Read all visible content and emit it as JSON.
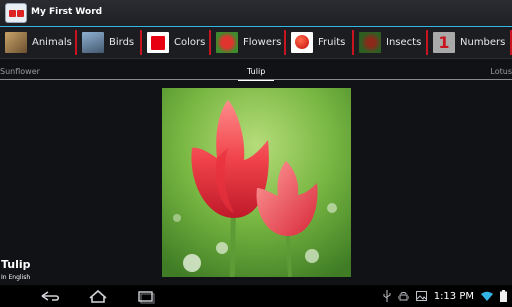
{
  "actionbar": {
    "title": "My First Word",
    "icon": "app-logo-icon"
  },
  "categories": [
    {
      "label": "Animals",
      "icon": "animals-thumbnail-icon"
    },
    {
      "label": "Birds",
      "icon": "birds-thumbnail-icon"
    },
    {
      "label": "Colors",
      "icon": "colors-thumbnail-icon"
    },
    {
      "label": "Flowers",
      "icon": "flowers-thumbnail-icon"
    },
    {
      "label": "Fruits",
      "icon": "fruits-thumbnail-icon"
    },
    {
      "label": "Insects",
      "icon": "insects-thumbnail-icon"
    },
    {
      "label": "Numbers",
      "icon": "numbers-thumbnail-icon",
      "glyph": "1"
    }
  ],
  "pager": {
    "previous": "Sunflower",
    "current": "Tulip",
    "next": "Lotus"
  },
  "content": {
    "word": "Tulip",
    "language": "In English",
    "image": "tulip-photo"
  },
  "status": {
    "time": "1:13 PM",
    "icons": [
      "usb-icon",
      "android-debug-icon",
      "photo-icon",
      "wifi-icon",
      "battery-icon"
    ]
  },
  "colors": {
    "accent": "#33b5e5",
    "separator": "#c8141e",
    "background": "#111215"
  }
}
